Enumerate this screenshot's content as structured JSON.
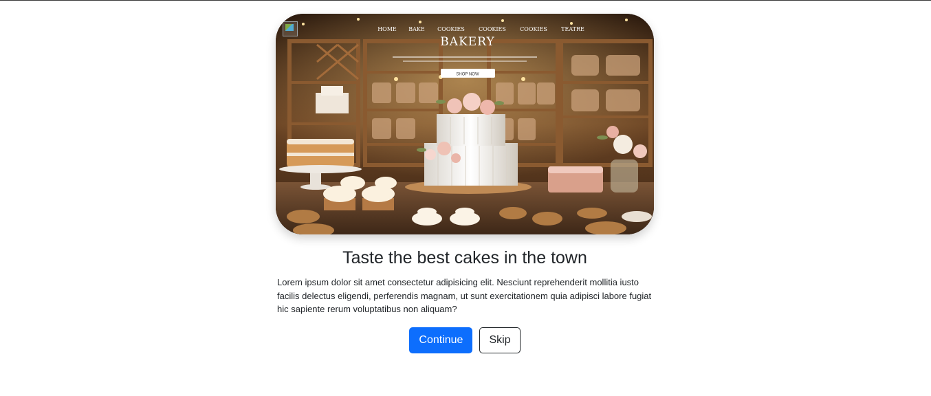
{
  "hero": {
    "brand_text": "BAKERY",
    "nav_items": [
      "HOME",
      "BAKE",
      "COOKIES",
      "COOKIES",
      "COOKIES",
      "TEATRE"
    ],
    "cta_text": "SHOP NOW",
    "image_alt": "Bakery display with tiered cake, cupcakes and cookies"
  },
  "content": {
    "headline": "Taste the best cakes in the town",
    "body": "Lorem ipsum dolor sit amet consectetur adipisicing elit. Nesciunt reprehenderit mollitia iusto facilis delectus eligendi, perferendis magnam, ut sunt exercitationem quia adipisci labore fugiat hic sapiente rerum voluptatibus non aliquam?"
  },
  "actions": {
    "continue_label": "Continue",
    "skip_label": "Skip"
  },
  "colors": {
    "primary": "#0d6efd",
    "text": "#212529"
  }
}
